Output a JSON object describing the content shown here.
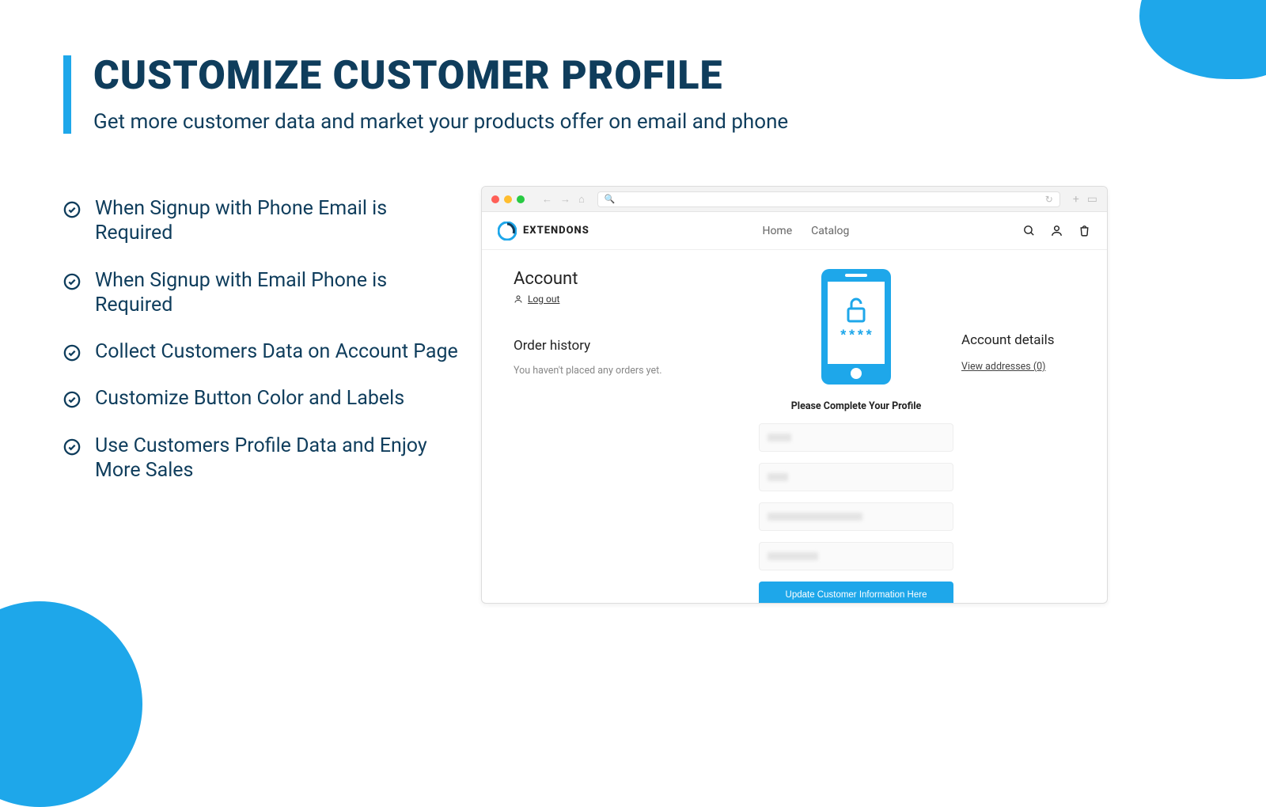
{
  "heading": {
    "title": "CUSTOMIZE CUSTOMER PROFILE",
    "subtitle": "Get more customer data and market your products offer on email and phone"
  },
  "features": [
    "When Signup with Phone Email is Required",
    "When Signup with Email Phone is Required",
    "Collect Customers Data on Account Page",
    "Customize Button Color and Labels",
    "Use Customers Profile Data and Enjoy More Sales"
  ],
  "store": {
    "brand": "EXTENDONS",
    "nav": {
      "home": "Home",
      "catalog": "Catalog"
    },
    "account": {
      "heading": "Account",
      "logout": "Log out",
      "order_history": "Order history",
      "no_orders": "You haven't placed any orders yet.",
      "complete_profile": "Please Complete Your Profile",
      "update_button": "Update Customer Information Here",
      "details_heading": "Account details",
      "view_addresses": "View addresses (0)"
    }
  },
  "colors": {
    "accent": "#1ea7ea",
    "dark": "#0f3d5c"
  }
}
